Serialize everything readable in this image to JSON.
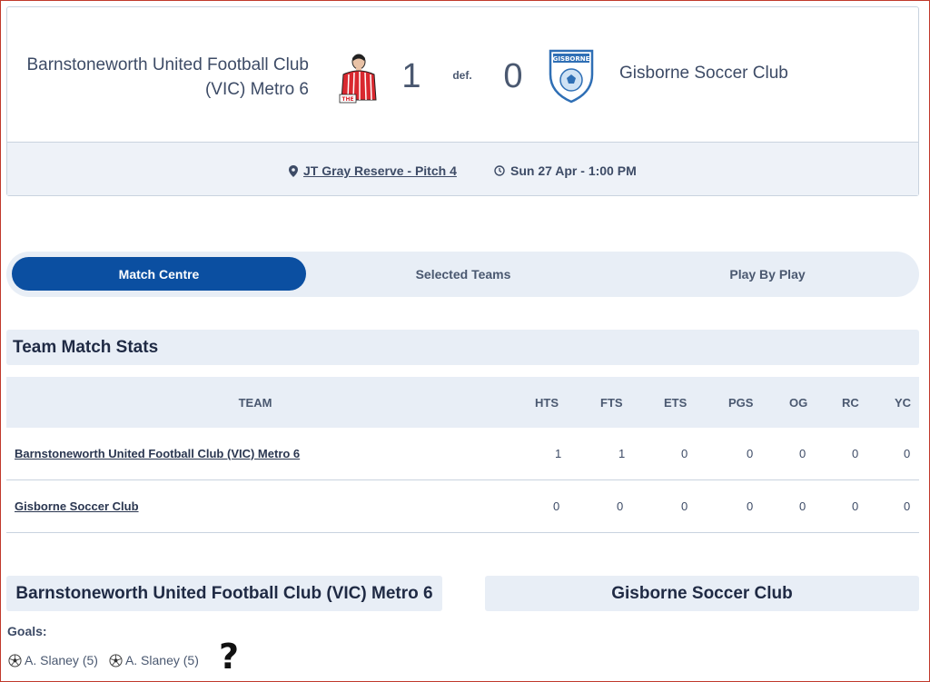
{
  "match": {
    "home_team": "Barnstoneworth United Football Club (VIC) Metro 6",
    "home_score": "1",
    "result_label": "def.",
    "away_score": "0",
    "away_team": "Gisborne Soccer Club",
    "venue": "JT Gray Reserve - Pitch 4",
    "datetime": "Sun 27 Apr - 1:00 PM",
    "home_logo_text": "THE",
    "away_logo_text": "GISBORNE"
  },
  "tabs": [
    {
      "label": "Match Centre",
      "active": true
    },
    {
      "label": "Selected Teams",
      "active": false
    },
    {
      "label": "Play By Play",
      "active": false
    }
  ],
  "stats": {
    "title": "Team Match Stats",
    "headers": [
      "TEAM",
      "HTS",
      "FTS",
      "ETS",
      "PGS",
      "OG",
      "RC",
      "YC"
    ],
    "rows": [
      {
        "team": "Barnstoneworth United Football Club (VIC) Metro 6",
        "values": [
          "1",
          "1",
          "0",
          "0",
          "0",
          "0",
          "0"
        ]
      },
      {
        "team": "Gisborne Soccer Club",
        "values": [
          "0",
          "0",
          "0",
          "0",
          "0",
          "0",
          "0"
        ]
      }
    ]
  },
  "home_panel": {
    "title": "Barnstoneworth United Football Club (VIC) Metro 6",
    "goals_label": "Goals:",
    "goals": [
      "A. Slaney (5)",
      "A. Slaney (5)"
    ]
  },
  "away_panel": {
    "title": "Gisborne Soccer Club"
  },
  "annotation": "?",
  "colors": {
    "accent": "#0b4fa1",
    "panel_bg": "#e8eef6",
    "text": "#1f2a44"
  }
}
